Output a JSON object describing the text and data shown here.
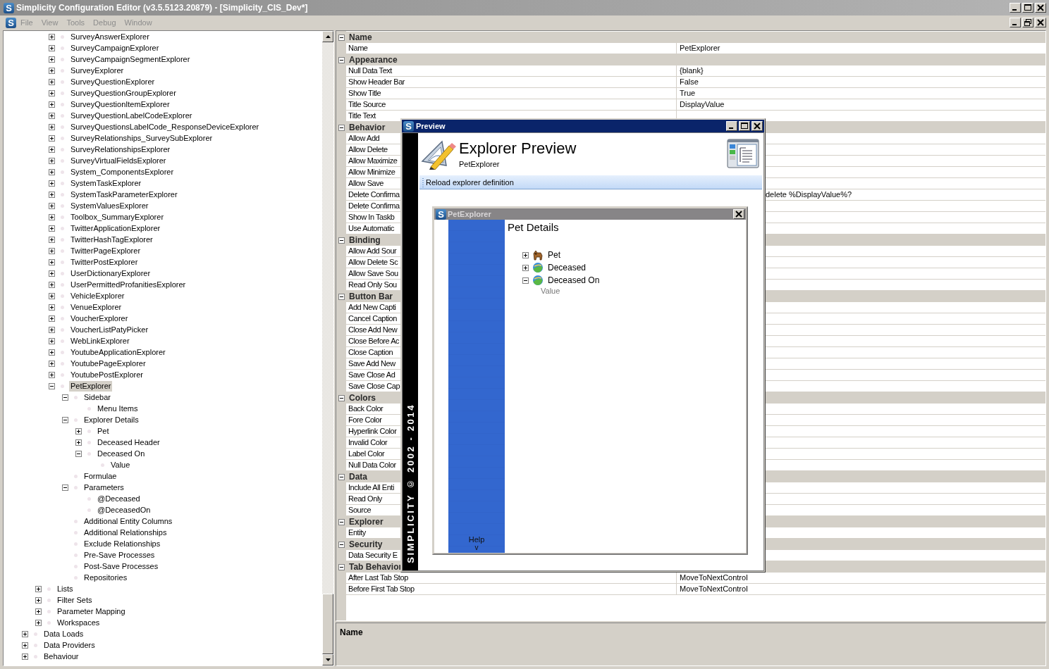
{
  "window": {
    "logo": "S",
    "title": "Simplicity Configuration Editor (v3.5.5123.20879) - [Simplicity_CIS_Dev*]"
  },
  "menu": {
    "logo": "S",
    "items": [
      {
        "label": "File",
        "disabled": true
      },
      {
        "label": "View",
        "disabled": true
      },
      {
        "label": "Tools",
        "disabled": true
      },
      {
        "label": "Debug",
        "disabled": true
      },
      {
        "label": "Window",
        "disabled": true
      }
    ]
  },
  "tree": {
    "items": [
      {
        "children": [
          {
            "children": [
              {
                "label": "SurveyAnswerExplorer",
                "expanded": false,
                "selected": false
              },
              {
                "label": "SurveyCampaignExplorer",
                "expanded": false,
                "selected": false
              },
              {
                "label": "SurveyCampaignSegmentExplorer",
                "expanded": false,
                "selected": false
              },
              {
                "label": "SurveyExplorer",
                "expanded": false,
                "selected": false
              },
              {
                "label": "SurveyQuestionExplorer",
                "expanded": false,
                "selected": false
              },
              {
                "label": "SurveyQuestionGroupExplorer",
                "expanded": false,
                "selected": false
              },
              {
                "label": "SurveyQuestionItemExplorer",
                "expanded": false,
                "selected": false
              },
              {
                "label": "SurveyQuestionLabelCodeExplorer",
                "expanded": false,
                "selected": false
              },
              {
                "label": "SurveyQuestionsLabelCode_ResponseDeviceExplorer",
                "expanded": false,
                "selected": false
              },
              {
                "label": "SurveyRelationships_SurveySubExplorer",
                "expanded": false,
                "selected": false
              },
              {
                "label": "SurveyRelationshipsExplorer",
                "expanded": false,
                "selected": false
              },
              {
                "label": "SurveyVirtualFieldsExplorer",
                "expanded": false,
                "selected": false
              },
              {
                "label": "System_ComponentsExplorer",
                "expanded": false,
                "selected": false
              },
              {
                "label": "SystemTaskExplorer",
                "expanded": false,
                "selected": false
              },
              {
                "label": "SystemTaskParameterExplorer",
                "expanded": false,
                "selected": false
              },
              {
                "label": "SystemValuesExplorer",
                "expanded": false,
                "selected": false
              },
              {
                "label": "Toolbox_SummaryExplorer",
                "expanded": false,
                "selected": false
              },
              {
                "label": "TwitterApplicationExplorer",
                "expanded": false,
                "selected": false
              },
              {
                "label": "TwitterHashTagExplorer",
                "expanded": false,
                "selected": false
              },
              {
                "label": "TwitterPageExplorer",
                "expanded": false,
                "selected": false
              },
              {
                "label": "TwitterPostExplorer",
                "expanded": false,
                "selected": false
              },
              {
                "label": "UserDictionaryExplorer",
                "expanded": false,
                "selected": false
              },
              {
                "label": "UserPermittedProfanitiesExplorer",
                "expanded": false,
                "selected": false
              },
              {
                "label": "VehicleExplorer",
                "expanded": false,
                "selected": false
              },
              {
                "label": "VenueExplorer",
                "expanded": false,
                "selected": false
              },
              {
                "label": "VoucherExplorer",
                "expanded": false,
                "selected": false
              },
              {
                "label": "VoucherListPatyPicker",
                "expanded": false,
                "selected": false
              },
              {
                "label": "WebLinkExplorer",
                "expanded": false,
                "selected": false
              },
              {
                "label": "YoutubeApplicationExplorer",
                "expanded": false,
                "selected": false
              },
              {
                "label": "YoutubePageExplorer",
                "expanded": false,
                "selected": false
              },
              {
                "label": "YoutubePostExplorer",
                "expanded": false,
                "selected": false
              },
              {
                "label": "PetExplorer",
                "expanded": true,
                "selected": true,
                "children": [
                  {
                    "label": "Sidebar",
                    "expanded": true,
                    "selected": false,
                    "children": [
                      {
                        "label": "Menu Items",
                        "selected": false
                      }
                    ]
                  },
                  {
                    "label": "Explorer Details",
                    "expanded": true,
                    "selected": false,
                    "children": [
                      {
                        "label": "Pet",
                        "expanded": false,
                        "selected": false
                      },
                      {
                        "label": "Deceased Header",
                        "expanded": false,
                        "selected": false
                      },
                      {
                        "label": "Deceased On",
                        "expanded": true,
                        "selected": false,
                        "children": [
                          {
                            "label": "Value",
                            "selected": false
                          }
                        ]
                      }
                    ]
                  },
                  {
                    "label": "Formulae",
                    "selected": false
                  },
                  {
                    "label": "Parameters",
                    "expanded": true,
                    "selected": false,
                    "children": [
                      {
                        "label": "@Deceased",
                        "selected": false
                      },
                      {
                        "label": "@DeceasedOn",
                        "selected": false
                      }
                    ]
                  },
                  {
                    "label": "Additional Entity Columns",
                    "selected": false
                  },
                  {
                    "label": "Additional Relationships",
                    "selected": false
                  },
                  {
                    "label": "Exclude Relationships",
                    "selected": false
                  },
                  {
                    "label": "Pre-Save Processes",
                    "selected": false
                  },
                  {
                    "label": "Post-Save Processes",
                    "selected": false
                  },
                  {
                    "label": "Repositories",
                    "selected": false
                  }
                ]
              }
            ]
          },
          {
            "label": "Lists",
            "expanded": false,
            "selected": false
          },
          {
            "label": "Filter Sets",
            "expanded": false,
            "selected": false
          },
          {
            "label": "Parameter Mapping",
            "expanded": false,
            "selected": false
          },
          {
            "label": "Workspaces",
            "expanded": false,
            "selected": false
          }
        ]
      },
      {
        "label": "Data Loads",
        "expanded": false,
        "selected": false
      },
      {
        "label": "Data Providers",
        "expanded": false,
        "selected": false
      },
      {
        "label": "Behaviour",
        "expanded": false,
        "selected": false
      }
    ]
  },
  "properties": {
    "groups": [
      {
        "category": "Name",
        "expanded": true,
        "rows": [
          {
            "name": "Name",
            "value": "PetExplorer"
          }
        ]
      },
      {
        "category": "Appearance",
        "expanded": true,
        "rows": [
          {
            "name": "Null Data Text",
            "value": "{blank}"
          },
          {
            "name": "Show Header Bar",
            "value": "False"
          },
          {
            "name": "Show Title",
            "value": "True"
          },
          {
            "name": "Title Source",
            "value": "DisplayValue"
          },
          {
            "name": "Title Text"
          }
        ]
      },
      {
        "category": "Behavior",
        "expanded": true,
        "rows": [
          {
            "name": "Allow Add"
          },
          {
            "name": "Allow Delete"
          },
          {
            "name": "Allow Maximize"
          },
          {
            "name": "Allow Minimize"
          },
          {
            "name": "Allow Save"
          },
          {
            "name": "Delete Confirma",
            "value": "delete %DisplayValue%?",
            "value_behind_preview": true
          },
          {
            "name": "Delete Confirma"
          },
          {
            "name": "Show In Taskb"
          },
          {
            "name": "Use Automatic"
          }
        ]
      },
      {
        "category": "Binding",
        "expanded": true,
        "rows": [
          {
            "name": "Allow Add Sour"
          },
          {
            "name": "Allow Delete Sc"
          },
          {
            "name": "Allow Save Sou"
          },
          {
            "name": "Read Only Sou"
          }
        ]
      },
      {
        "category": "Button Bar",
        "expanded": true,
        "rows": [
          {
            "name": "Add New Capti"
          },
          {
            "name": "Cancel Caption"
          },
          {
            "name": "Close Add New"
          },
          {
            "name": "Close Before Ac"
          },
          {
            "name": "Close Caption"
          },
          {
            "name": "Save Add New"
          },
          {
            "name": "Save Close Ad"
          },
          {
            "name": "Save Close Cap"
          }
        ]
      },
      {
        "category": "Colors",
        "expanded": true,
        "rows": [
          {
            "name": "Back Color"
          },
          {
            "name": "Fore Color"
          },
          {
            "name": "Hyperlink Color"
          },
          {
            "name": "Invalid Color"
          },
          {
            "name": "Label Color"
          },
          {
            "name": "Null Data Color"
          }
        ]
      },
      {
        "category": "Data",
        "expanded": true,
        "rows": [
          {
            "name": "Include All Enti"
          },
          {
            "name": "Read Only"
          },
          {
            "name": "Source"
          }
        ]
      },
      {
        "category": "Explorer",
        "expanded": true,
        "rows": [
          {
            "name": "Entity"
          }
        ]
      },
      {
        "category": "Security",
        "expanded": true,
        "rows": [
          {
            "name": "Data Security E"
          }
        ]
      },
      {
        "category": "Tab Behavior",
        "expanded": true,
        "rows": [
          {
            "name": "After Last Tab Stop",
            "value": "MoveToNextControl"
          },
          {
            "name": "Before First Tab Stop",
            "value": "MoveToNextControl"
          }
        ]
      }
    ]
  },
  "description": {
    "title": "Name"
  },
  "preview": {
    "logo": "S",
    "title": "Preview",
    "brand": "SIMPLICITY © 2002 - 2014",
    "heading": "Explorer Preview",
    "subtitle": "PetExplorer",
    "toolbar": [
      "Reload explorer definition"
    ],
    "explorer": {
      "logo": "S",
      "title": "PetExplorer",
      "heading": "Pet Details",
      "sidebar_link": "Help",
      "sidebar_more": "v",
      "items": [
        {
          "label": "Pet",
          "kind": "animal",
          "expanded": false
        },
        {
          "label": "Deceased",
          "kind": "field",
          "expanded": false
        },
        {
          "label": "Deceased On",
          "kind": "field",
          "expanded": true,
          "children": [
            {
              "label": "Value"
            }
          ]
        }
      ]
    }
  }
}
